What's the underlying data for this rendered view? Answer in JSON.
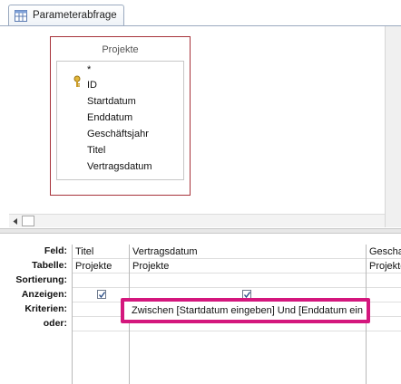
{
  "tab": {
    "label": "Parameterabfrage",
    "icon": "query-icon"
  },
  "table": {
    "title": "Projekte",
    "fields": [
      "*",
      "ID",
      "Startdatum",
      "Enddatum",
      "Geschäftsjahr",
      "Titel",
      "Vertragsdatum"
    ],
    "primary_key_icon": "key-icon"
  },
  "grid": {
    "row_labels": [
      "Feld:",
      "Tabelle:",
      "Sortierung:",
      "Anzeigen:",
      "Kriterien:",
      "oder:"
    ],
    "columns": [
      {
        "field": "Titel",
        "table": "Projekte",
        "show": true,
        "criteria": ""
      },
      {
        "field": "Vertragsdatum",
        "table": "Projekte",
        "show": true,
        "criteria": "Zwischen [Startdatum eingeben] Und [Enddatum eingeben]"
      },
      {
        "field": "Gescha",
        "table": "Projekte",
        "show": false,
        "criteria": ""
      }
    ]
  },
  "colors": {
    "table_border": "#a7323a",
    "highlight": "#d4177d"
  }
}
